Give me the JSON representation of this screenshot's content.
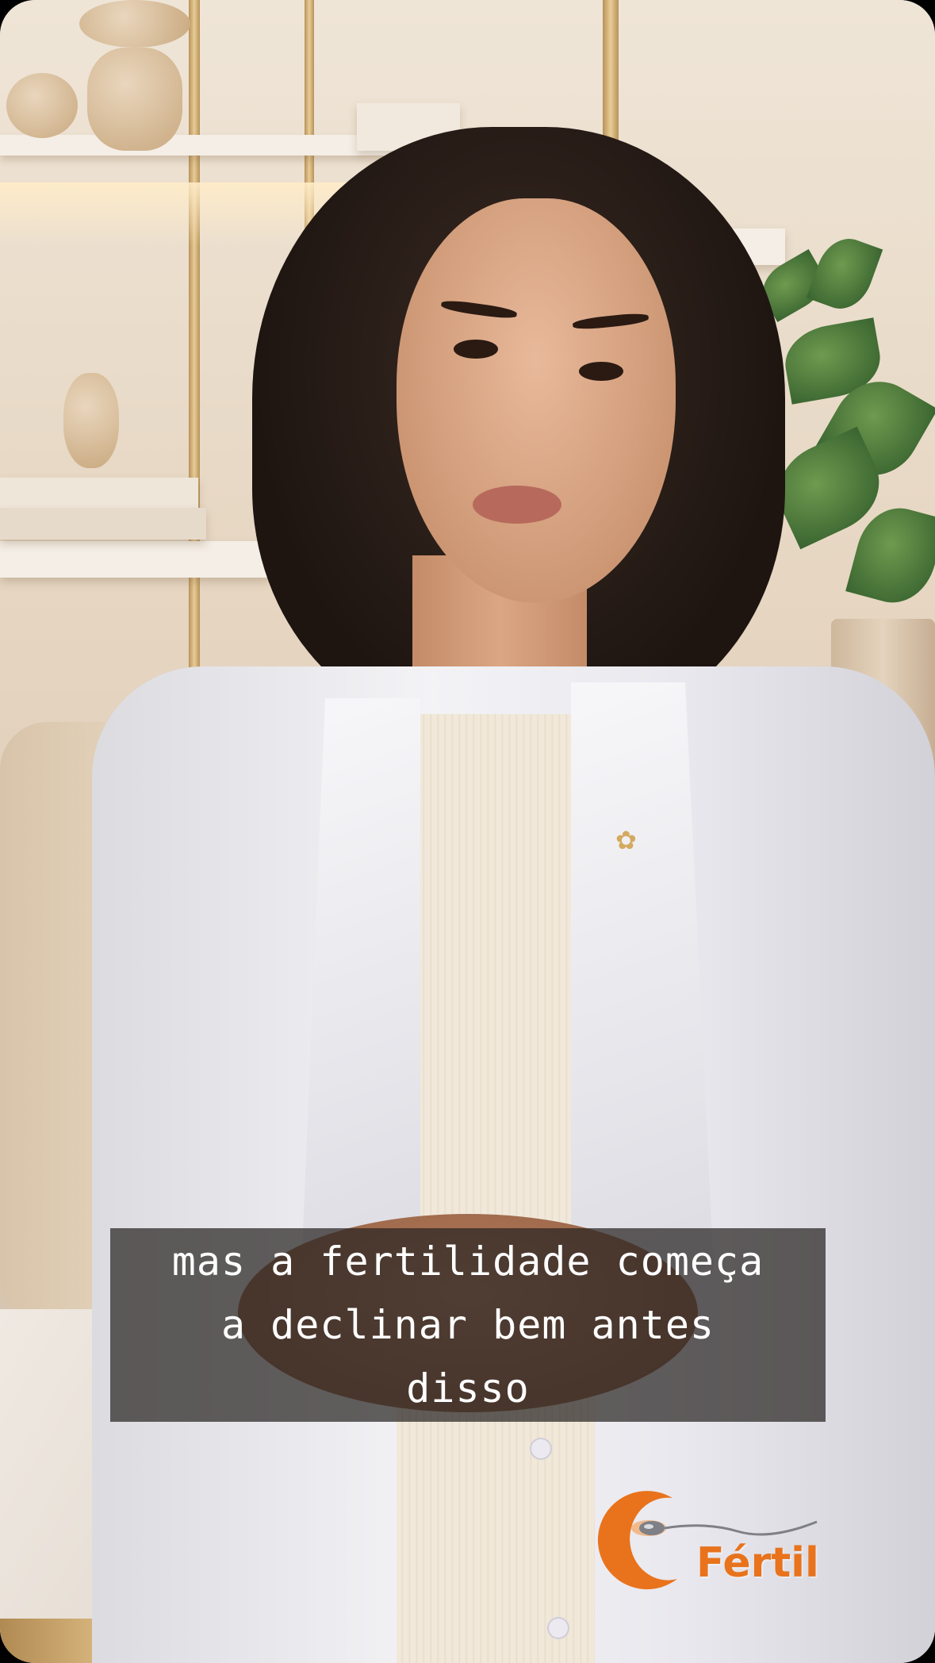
{
  "video": {
    "caption_lines": [
      "mas a fertilidade começa",
      "a declinar bem antes",
      "disso"
    ]
  },
  "logo": {
    "text": "Fértil",
    "color": "#e8731c",
    "icon": "c-crescent-sperm-icon"
  },
  "colors": {
    "caption_bg": "#28241f",
    "caption_text": "#ffffff"
  }
}
